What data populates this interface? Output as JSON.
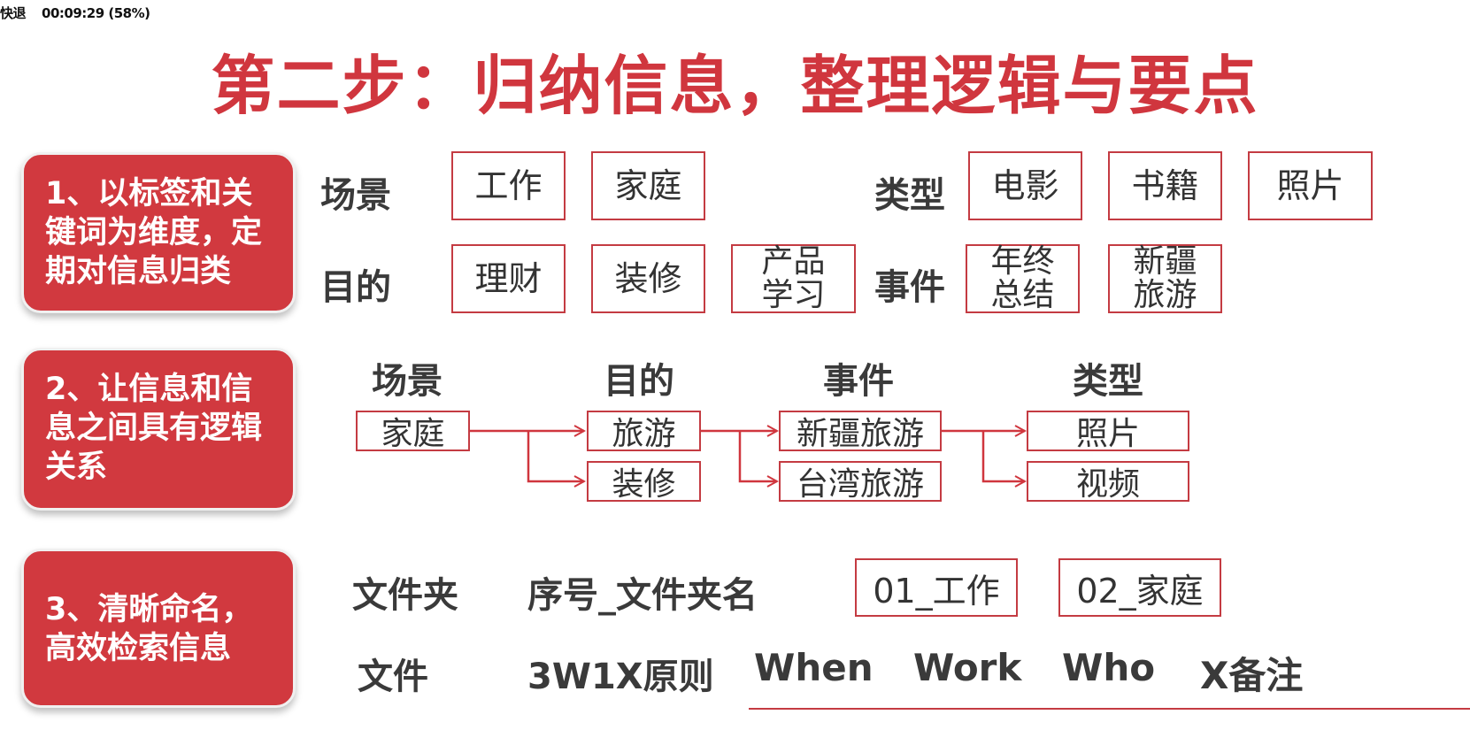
{
  "overlay": {
    "left": "快退",
    "time": "00:09:29 (58%)"
  },
  "title": "第二步：归纳信息，整理逻辑与要点",
  "section1": {
    "label": "1、以标签和关键词为维度，定期对信息归类",
    "row1": {
      "label_a": "场景",
      "tags_a": [
        "工作",
        "家庭"
      ],
      "label_b": "类型",
      "tags_b": [
        "电影",
        "书籍",
        "照片"
      ]
    },
    "row2": {
      "label_a": "目的",
      "tags_a": [
        "理财",
        "装修",
        "产品\n学习"
      ],
      "label_b": "事件",
      "tags_b": [
        "年终\n总结",
        "新疆\n旅游"
      ]
    }
  },
  "section2": {
    "label": "2、让信息和信息之间具有逻辑关系",
    "headers": [
      "场景",
      "目的",
      "事件",
      "类型"
    ],
    "nodes": {
      "scene": "家庭",
      "purpose": [
        "旅游",
        "装修"
      ],
      "event": [
        "新疆旅游",
        "台湾旅游"
      ],
      "type": [
        "照片",
        "视频"
      ]
    },
    "colors": {
      "line": "#d0363e"
    }
  },
  "section3": {
    "label": "3、清晰命名，高效检索信息",
    "folder_label": "文件夹",
    "folder_rule": "序号_文件夹名",
    "folder_examples": [
      "01_工作",
      "02_家庭"
    ],
    "file_label": "文件",
    "file_rule": "3W1X原则",
    "file_parts": [
      "When",
      "Work",
      "Who",
      "X备注"
    ]
  },
  "colors": {
    "accent": "#d0363e",
    "box_fill": "#d1393f",
    "text": "#3a3a3a"
  }
}
